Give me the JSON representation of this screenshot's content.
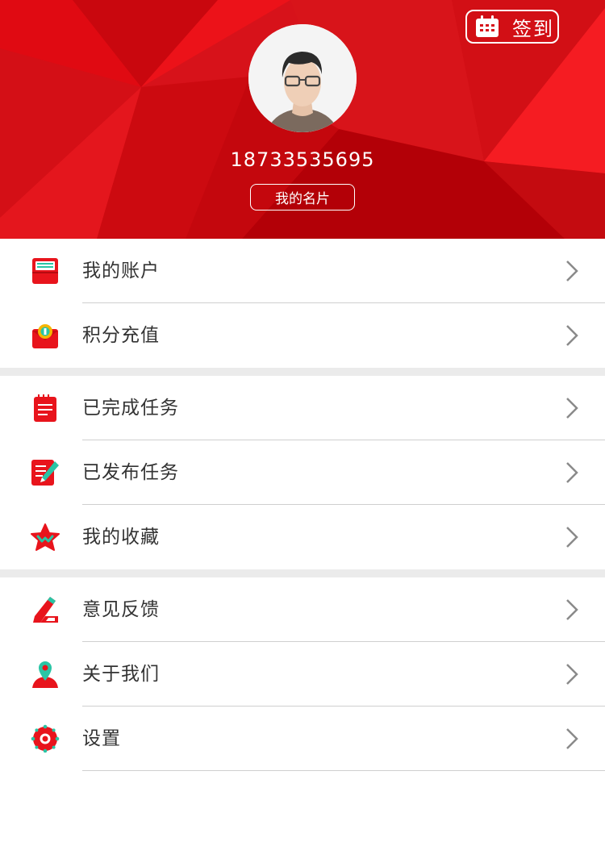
{
  "header": {
    "checkin_label": "签到",
    "phone": "18733535695",
    "card_button_label": "我的名片",
    "colors": {
      "base": "#d7121a",
      "light": "#f0171d",
      "dark": "#b80008"
    }
  },
  "menu_groups": [
    {
      "items": [
        {
          "label": "我的账户",
          "icon": "wallet-icon"
        },
        {
          "label": "积分充值",
          "icon": "points-recharge-icon"
        }
      ]
    },
    {
      "items": [
        {
          "label": "已完成任务",
          "icon": "completed-task-icon"
        },
        {
          "label": "已发布任务",
          "icon": "published-task-icon"
        },
        {
          "label": "我的收藏",
          "icon": "favorite-star-icon"
        }
      ]
    },
    {
      "items": [
        {
          "label": "意见反馈",
          "icon": "feedback-pen-icon"
        },
        {
          "label": "关于我们",
          "icon": "about-person-icon"
        },
        {
          "label": "设置",
          "icon": "settings-gear-icon"
        }
      ]
    }
  ],
  "colors": {
    "icon_red": "#e8141c",
    "icon_teal": "#29c5a5",
    "chevron": "#8a8a8a"
  }
}
